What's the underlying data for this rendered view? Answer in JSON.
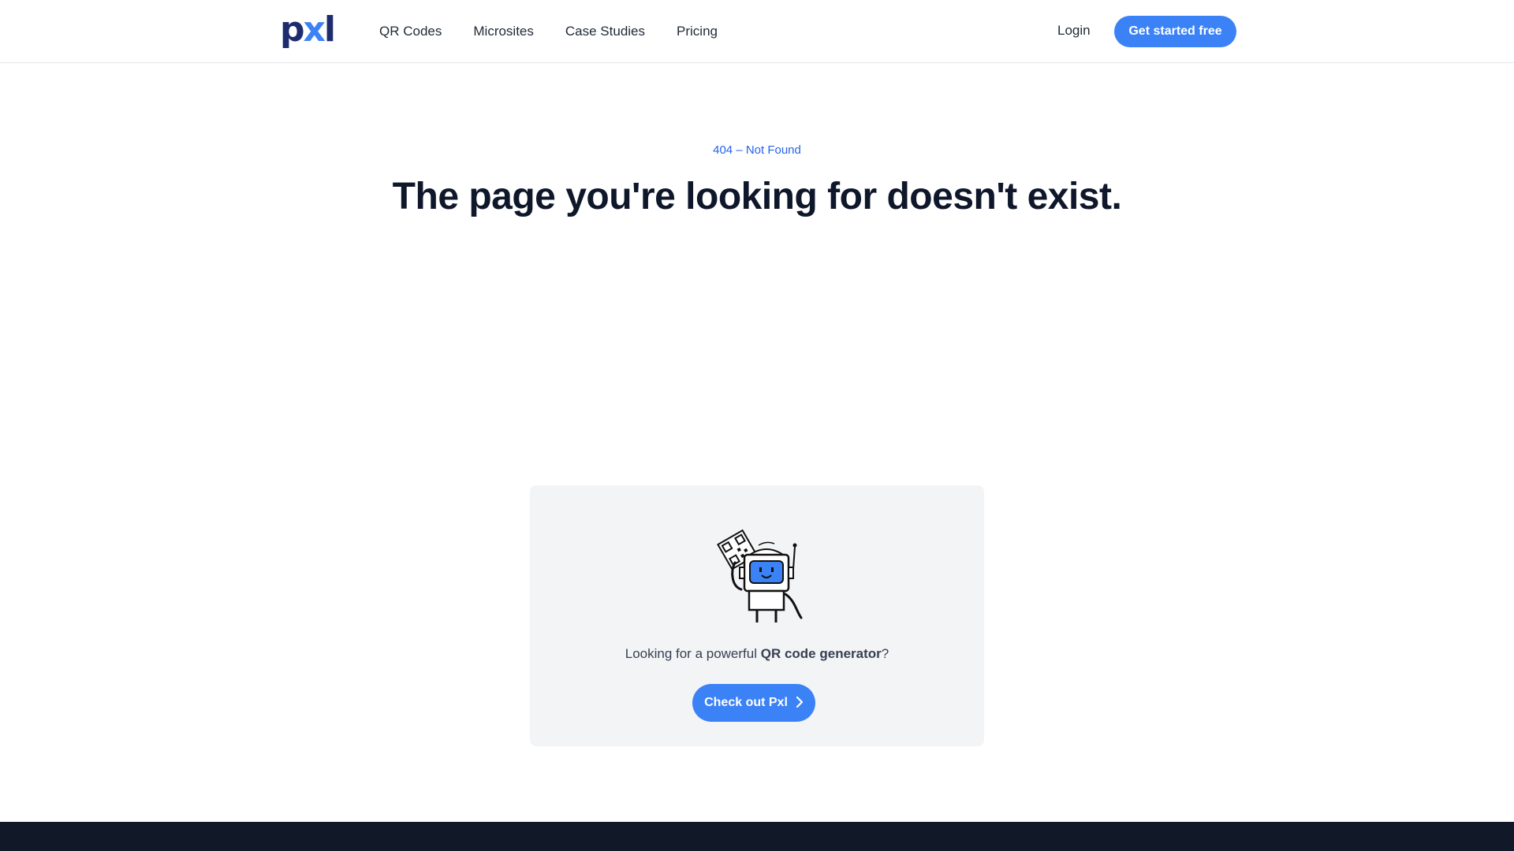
{
  "header": {
    "logo": {
      "p": "p",
      "x": "x",
      "l": "l"
    },
    "nav": [
      "QR Codes",
      "Microsites",
      "Case Studies",
      "Pricing"
    ],
    "login_label": "Login",
    "cta_label": "Get started free"
  },
  "main": {
    "eyebrow": "404 – Not Found",
    "headline": "The page you're looking for doesn't exist."
  },
  "card": {
    "text_prefix": "Looking for a powerful ",
    "text_bold": "QR code generator",
    "text_suffix": "?",
    "button_label": "Check out Pxl",
    "button_icon": "chevron-right-icon",
    "illustration": "robot-holding-qr-code"
  },
  "colors": {
    "accent": "#3b82f6",
    "text_dark": "#0f172a",
    "card_bg": "#f3f4f6",
    "footer_bg": "#111827"
  }
}
